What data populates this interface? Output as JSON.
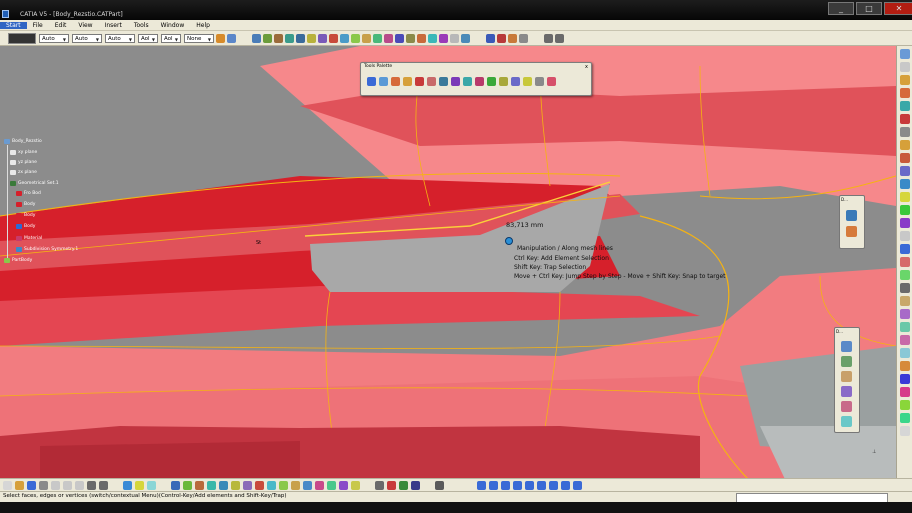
{
  "window": {
    "title": "CATIA V5 - [Body_Rezstio.CATPart]",
    "buttons": [
      "_",
      "□",
      "✕"
    ]
  },
  "menubar": {
    "items": [
      "Start",
      "File",
      "Edit",
      "View",
      "Insert",
      "Tools",
      "Window",
      "Help"
    ]
  },
  "toolbar": {
    "combos": [
      {
        "name": "line-color",
        "value": "Auto"
      },
      {
        "name": "line-thickness",
        "value": "Auto"
      },
      {
        "name": "line-type",
        "value": "Auto"
      },
      {
        "name": "layer",
        "value": "Aol"
      },
      {
        "name": "point-type",
        "value": "Aol"
      },
      {
        "name": "rendering",
        "value": "None"
      }
    ]
  },
  "tree": {
    "nodes": [
      {
        "label": "Body_Rezstio"
      },
      {
        "label": "xy plane"
      },
      {
        "label": "yz plane"
      },
      {
        "label": "zx plane"
      },
      {
        "label": "Geometrical Set.1"
      },
      {
        "label": "Fro Bod"
      },
      {
        "label": "Body"
      },
      {
        "label": "Body"
      },
      {
        "label": "Body"
      },
      {
        "label": "Material"
      },
      {
        "label": "Subdivision Symmetry.1"
      },
      {
        "label": "PartBody"
      }
    ]
  },
  "tools_palette": {
    "title": "Tools Palette",
    "close": "x"
  },
  "annotations": {
    "dimension": "83,713 mm",
    "hints": [
      "Manipulation / Along mesh lines",
      "Ctrl Key: Add Element Selection",
      "Shift Key: Trap Selection",
      "Move + Ctrl Key: Jump Step by Step - Move + Shift Key: Snap to target"
    ],
    "stat_label": "St"
  },
  "floating_palettes": {
    "p1": "D...",
    "p2": "D..."
  },
  "status": {
    "text": "Select faces, edges or vertices (switch/contextual Menu)(Control-Key/Add elements and Shift-Key/Trap)",
    "command_field": ""
  },
  "colors": {
    "surface_dark": "#d6202b",
    "surface_mid": "#e0525a",
    "surface_light": "#f27c80",
    "mesh_line": "#f5b312",
    "background": "#8c8c8c"
  }
}
